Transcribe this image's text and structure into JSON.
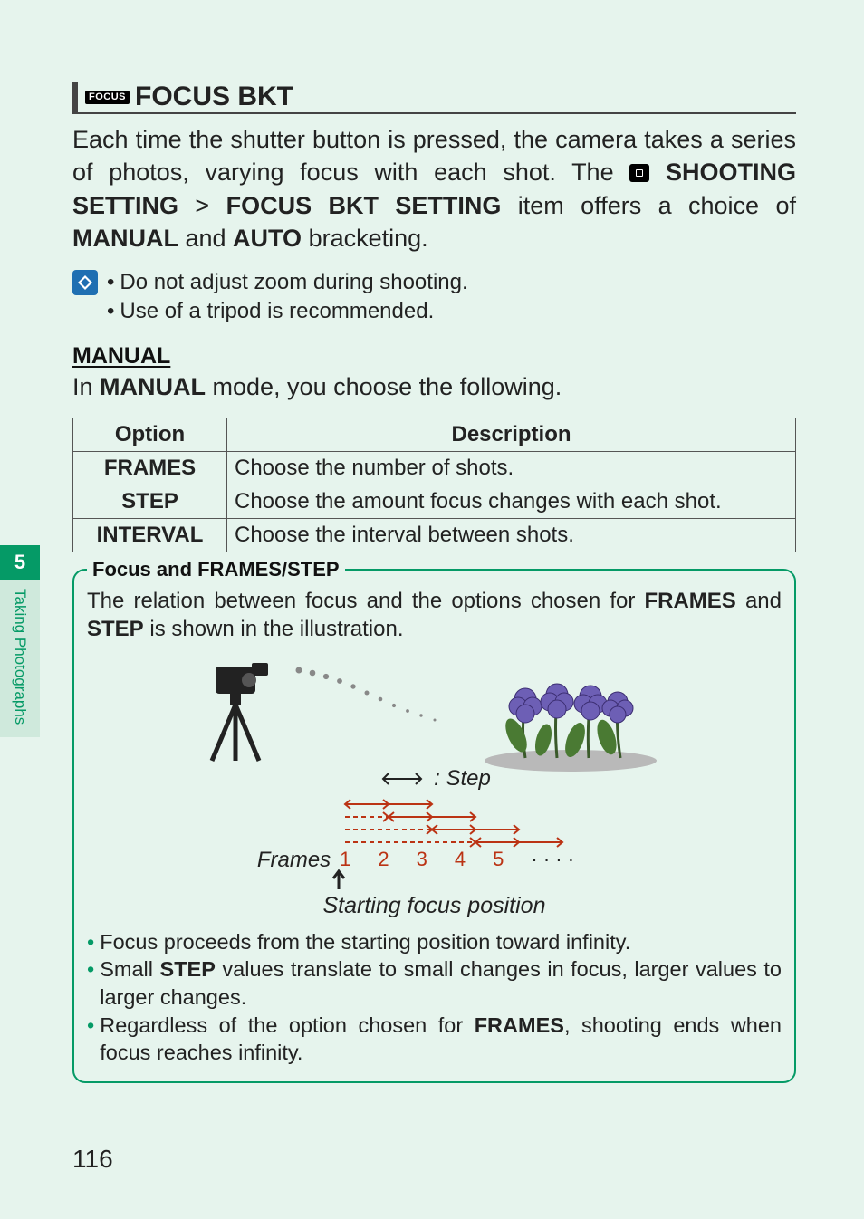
{
  "sidebar": {
    "chapter_number": "5",
    "chapter_label": "Taking Photographs"
  },
  "page_number": "116",
  "section": {
    "icon_badge_text": "FOCUS",
    "title": "FOCUS BKT"
  },
  "intro": {
    "part1": "Each time the shutter button is pressed, the camera takes a series of photos, varying focus with each shot. The ",
    "shooting": "SHOOTING SETTING",
    "gt": " > ",
    "focusbkt": "FOCUS BKT SETTING",
    "part2": " item offers a choice of ",
    "manual": "MANUAL",
    "and": " and ",
    "auto": "AUTO",
    "part3": " bracketing."
  },
  "tips": [
    "Do not adjust zoom during shooting.",
    "Use of a tripod is recommended."
  ],
  "manual": {
    "heading": "MANUAL",
    "lead_in": "In ",
    "lead_bold": "MANUAL",
    "lead_out": " mode, you choose the following."
  },
  "table": {
    "headers": {
      "option": "Option",
      "description": "Description"
    },
    "rows": [
      {
        "option": "FRAMES",
        "desc": "Choose the number of shots."
      },
      {
        "option": "STEP",
        "desc": "Choose the amount focus changes with each shot."
      },
      {
        "option": "INTERVAL",
        "desc": "Choose the interval between shots."
      }
    ]
  },
  "callout": {
    "title": "Focus and FRAMES/STEP",
    "intro_a": "The relation between focus and the options chosen for ",
    "intro_frames": "FRAMES",
    "intro_b": " and ",
    "intro_step": "STEP",
    "intro_c": " is shown in the illustration.",
    "step_label": ": Step",
    "frames_label": "Frames",
    "frame_numbers": [
      "1",
      "2",
      "3",
      "4",
      "5",
      " · · · ·"
    ],
    "start_label": "Starting focus position",
    "bullets": [
      {
        "pre": "Focus proceeds from the starting position toward infinity.",
        "bold": "",
        "post": ""
      },
      {
        "pre": "Small ",
        "bold": "STEP",
        "post": " values translate to small changes in focus, larger values to larger changes."
      },
      {
        "pre": "Regardless of the option chosen for ",
        "bold": "FRAMES",
        "post": ", shooting ends when focus reaches infinity."
      }
    ]
  }
}
